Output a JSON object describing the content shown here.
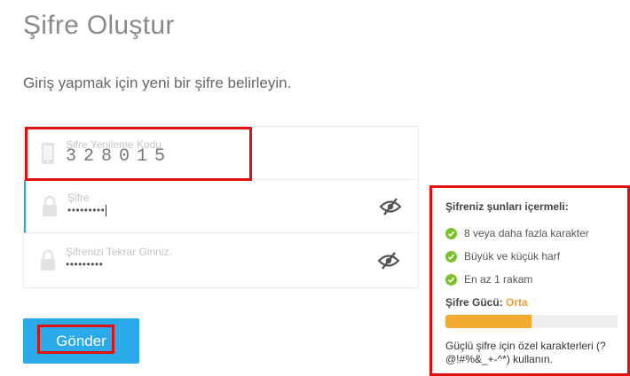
{
  "page": {
    "title": "Şifre Oluştur",
    "subtitle": "Giriş yapmak için yeni bir şifre belirleyin."
  },
  "form": {
    "code": {
      "label": "Şifre Yenileme Kodu",
      "value": "328015",
      "icon": "phone-icon"
    },
    "password": {
      "label": "Şifre",
      "value": "•••••••••",
      "icon": "lock-icon",
      "toggle_icon": "eye-slash-icon"
    },
    "confirm": {
      "label": "Şifrenizi Tekrar Giriniz.",
      "value": "•••••••••",
      "icon": "lock-icon",
      "toggle_icon": "eye-slash-icon"
    },
    "submit_label": "Gönder"
  },
  "requirements": {
    "heading": "Şifreniz şunları içermeli:",
    "items": [
      "8 veya daha fazla karakter",
      "Büyük ve küçük harf",
      "En az 1 rakam"
    ],
    "strength_label": "Şifre Gücü:",
    "strength_value": "Orta",
    "strength_fraction": 0.5,
    "tip": "Güçlü şifre için özel karakterleri (?@!#%&_+-^*) kullanın."
  },
  "colors": {
    "accent": "#2aaae9",
    "highlight": "#e01010",
    "check": "#7bc12b",
    "strength": "#f2ab30"
  }
}
